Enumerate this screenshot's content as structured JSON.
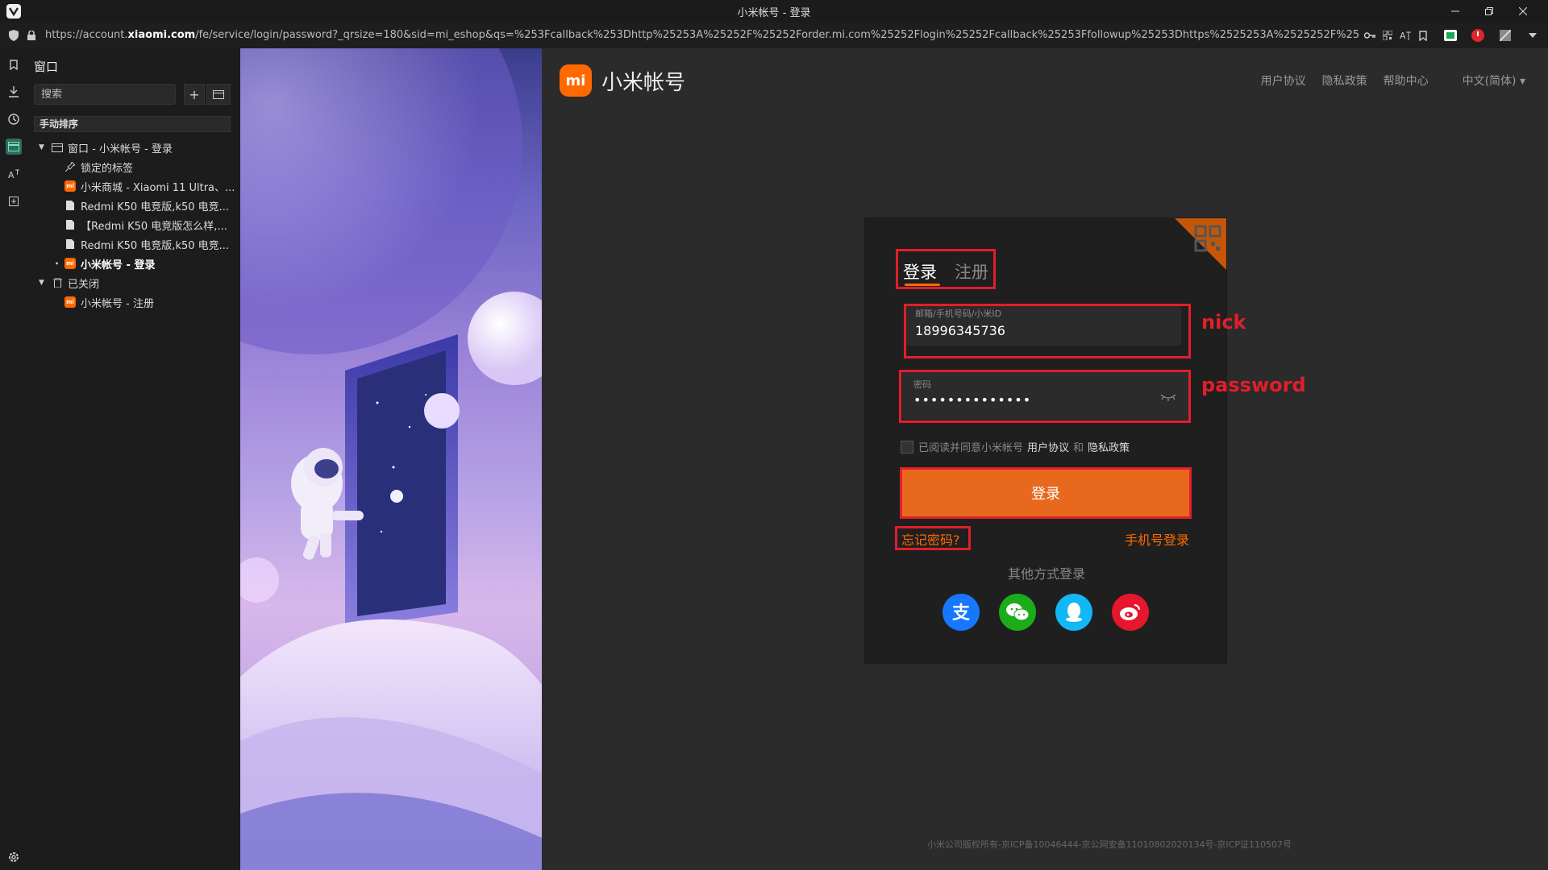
{
  "window": {
    "title": "小米帐号 - 登录",
    "url_prefix": "https://account.",
    "url_domain": "xiaomi.com",
    "url_rest": "/fe/service/login/password?_qrsize=180&sid=mi_eshop&qs=%253Fcallback%253Dhttp%25253A%25252F%25252Forder.mi.com%25252Flogin%25252Fcallback%25253Ffollowup%25253Dhttps%2525253A%2525252F%2525252Fwww.mi.com%2525252F%25..."
  },
  "panel": {
    "title": "窗口",
    "search_placeholder": "搜索",
    "sort_label": "手动排序",
    "tree": [
      {
        "label": "窗口 - 小米帐号 - 登录",
        "type": "window"
      },
      {
        "label": "锁定的标签",
        "type": "pinned"
      },
      {
        "label": "小米商城 - Xiaomi 11 Ultra、...",
        "type": "mi"
      },
      {
        "label": "Redmi K50 电竞版,k50 电竞...",
        "type": "page"
      },
      {
        "label": "【Redmi K50 电竞版怎么样,...",
        "type": "page"
      },
      {
        "label": "Redmi K50 电竞版,k50 电竞...",
        "type": "page"
      },
      {
        "label": "小米帐号 - 登录",
        "type": "mi"
      },
      {
        "label": "已关闭",
        "type": "trash"
      },
      {
        "label": "小米帐号 - 注册",
        "type": "mi"
      }
    ]
  },
  "brand": {
    "logo_text": "mi",
    "name": "小米帐号"
  },
  "topnav": {
    "items": [
      "用户协议",
      "隐私政策",
      "帮助中心",
      "中文(简体) ▾"
    ]
  },
  "login": {
    "tab_login": "登录",
    "tab_register": "注册",
    "account_label": "邮箱/手机号码/小米ID",
    "account_value": "18996345736",
    "password_label": "密码",
    "password_value": "••••••••••••••",
    "agree_prefix": "已阅读并同意小米帐号",
    "agree_terms": "用户协议",
    "agree_and": "和",
    "agree_privacy": "隐私政策",
    "submit": "登录",
    "forgot": "忘记密码?",
    "phone_login": "手机号登录",
    "other_methods": "其他方式登录"
  },
  "annotations": {
    "nick": "nick",
    "password": "password"
  },
  "footer": {
    "text": "小米公司版权所有-京ICP备10046444-京公网安备11010802020134号-京ICP证110507号"
  },
  "colors": {
    "accent": "#ff6900",
    "annotation_red": "#e01f2a",
    "alipay": "#1677ff",
    "wechat": "#1aad19",
    "qq": "#12b7f5",
    "weibo": "#e6162d"
  },
  "social_icons": [
    "alipay-icon",
    "wechat-icon",
    "qq-icon",
    "weibo-icon"
  ]
}
